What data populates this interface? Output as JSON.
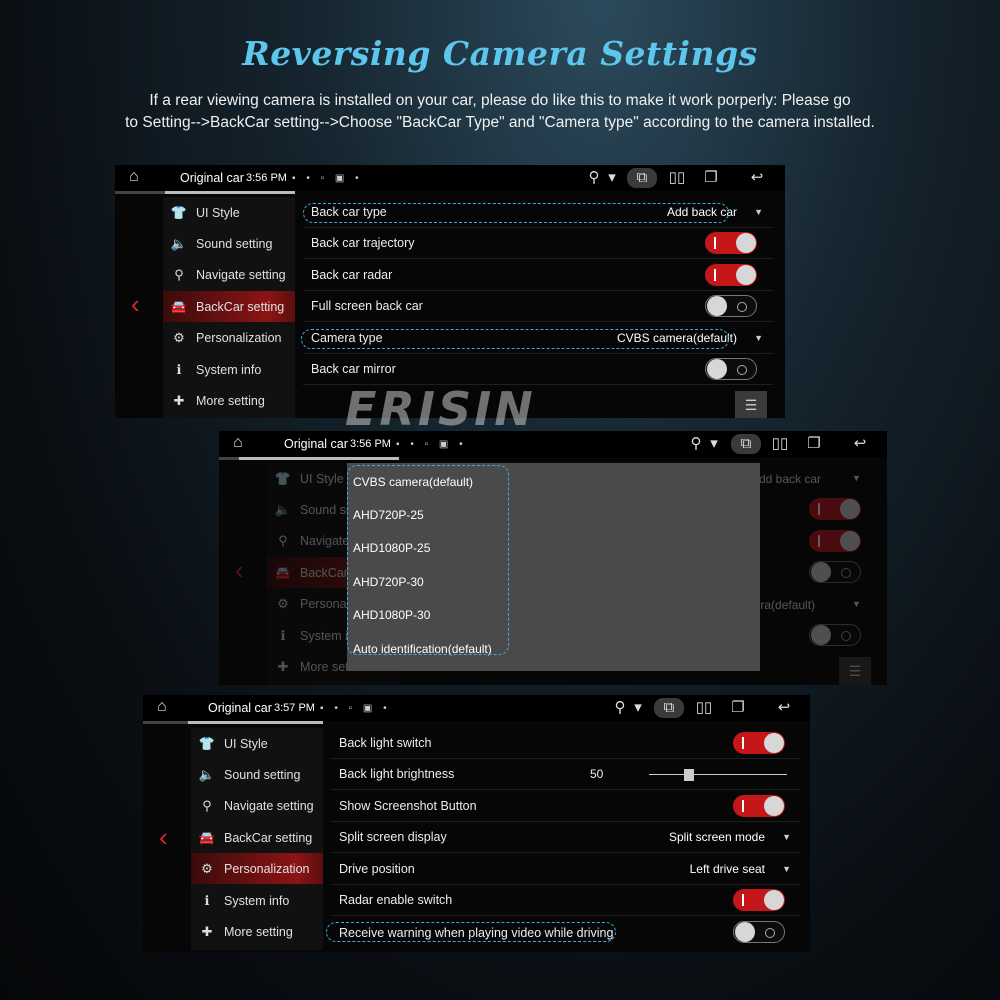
{
  "page": {
    "title": "Reversing Camera Settings",
    "desc_line1": "If a rear viewing camera is installed on your car, please do like this to make it work porperly: Please go",
    "desc_line2": "to Setting-->BackCar setting-->Choose \"BackCar Type\" and \"Camera type\" according to the camera installed.",
    "watermark": "ERISIN"
  },
  "icons": {
    "home": "⌂",
    "back": "↩",
    "left_arrow": "‹",
    "location": "⚲",
    "wifi": "▾",
    "screenshot": "⧉",
    "split": "▯▯",
    "windows": "❐",
    "dropdown": "▼",
    "list": "☰"
  },
  "colors": {
    "accent_red": "#c5161a",
    "highlight_blue": "#3aa9e6",
    "title_blue": "#5cc6ec"
  },
  "sidebar": {
    "items": [
      {
        "label": "UI Style",
        "icon": "shirt-icon",
        "glyph": "👕"
      },
      {
        "label": "Sound setting",
        "icon": "speaker-icon",
        "glyph": "🔈"
      },
      {
        "label": "Navigate setting",
        "icon": "location-pin-icon",
        "glyph": "⚲"
      },
      {
        "label": "BackCar setting",
        "icon": "car-icon",
        "glyph": "🚘"
      },
      {
        "label": "Personalization",
        "icon": "gear-icon",
        "glyph": "⚙"
      },
      {
        "label": "System info",
        "icon": "info-icon",
        "glyph": "ℹ"
      },
      {
        "label": "More setting",
        "icon": "puzzle-icon",
        "glyph": "✚"
      }
    ]
  },
  "screen1": {
    "car_name": "Original car",
    "time": "3:56 PM",
    "rows": [
      {
        "label": "Back car type",
        "value": "Add back car"
      },
      {
        "label": "Back car trajectory",
        "toggle": "on"
      },
      {
        "label": "Back car radar",
        "toggle": "on"
      },
      {
        "label": "Full screen back car",
        "toggle": "off"
      },
      {
        "label": "Camera type",
        "value": "CVBS camera(default)"
      },
      {
        "label": "Back car mirror",
        "toggle": "off"
      }
    ]
  },
  "screen2": {
    "car_name": "Original car",
    "time": "3:56 PM",
    "bg_value_1": "dd back car",
    "bg_value_2": "nera(default)",
    "options": [
      "CVBS camera(default)",
      "AHD720P-25",
      "AHD1080P-25",
      "AHD720P-30",
      "AHD1080P-30",
      "Auto identification(default)"
    ],
    "sidebar_partial": [
      "UI Style",
      "Sound se",
      "Navigate",
      "BackCar",
      "Personali",
      "System i",
      "More setti"
    ]
  },
  "screen3": {
    "car_name": "Original car",
    "time": "3:57 PM",
    "rows": [
      {
        "label": "Back light switch",
        "toggle": "on"
      },
      {
        "label": "Back light brightness",
        "value": "50",
        "level": 50
      },
      {
        "label": "Show Screenshot Button",
        "toggle": "on"
      },
      {
        "label": "Split screen display",
        "value": "Split screen mode"
      },
      {
        "label": "Drive position",
        "value": "Left drive seat"
      },
      {
        "label": "Radar enable switch",
        "toggle": "on"
      },
      {
        "label": "Receive warning when playing video while driving",
        "toggle": "off"
      }
    ]
  }
}
